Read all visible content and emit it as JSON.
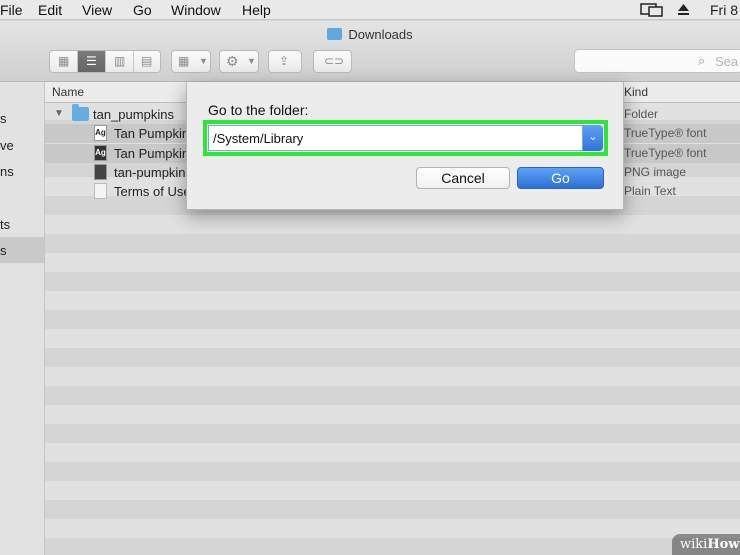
{
  "menubar": {
    "items": [
      "File",
      "Edit",
      "View",
      "Go",
      "Window",
      "Help"
    ],
    "clock": "Fri 8"
  },
  "window": {
    "title": "Downloads"
  },
  "toolbar": {
    "search_placeholder": "Sea"
  },
  "sidebar": {
    "items": [
      "s",
      "ve",
      "ns",
      "ts",
      "s"
    ],
    "selected_index": 4
  },
  "list": {
    "headers": {
      "name": "Name",
      "kind": "Kind"
    },
    "rows": [
      {
        "name": "tan_pumpkins",
        "kind": "Folder",
        "icon": "folder-icon",
        "badge": ""
      },
      {
        "name": "Tan Pumpkin",
        "kind": "TrueType® font",
        "icon": "font-file-icon",
        "badge": "Ag"
      },
      {
        "name": "Tan Pumpkin",
        "kind": "TrueType® font",
        "icon": "font-file-icon",
        "badge": "Ag"
      },
      {
        "name": "tan-pumpkin",
        "kind": "PNG image",
        "icon": "image-file-icon",
        "badge": ""
      },
      {
        "name": "Terms of Use",
        "kind": "Plain Text",
        "icon": "text-file-icon",
        "badge": ""
      }
    ]
  },
  "dialog": {
    "title": "Go to the folder:",
    "path_value": "/System/Library",
    "cancel_label": "Cancel",
    "go_label": "Go",
    "highlight_color": "#2ee636",
    "accent_color": "#2f73db"
  },
  "watermark": {
    "prefix": "wiki",
    "suffix": "How"
  }
}
